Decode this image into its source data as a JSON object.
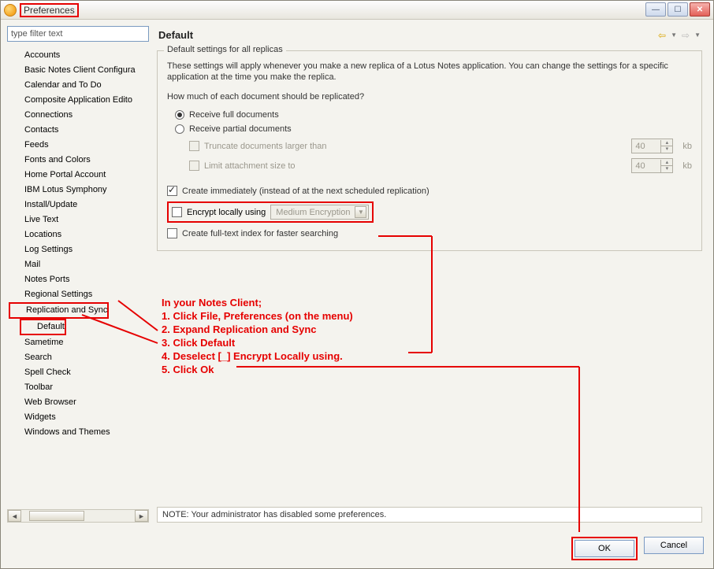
{
  "window": {
    "title": "Preferences"
  },
  "filter": {
    "placeholder": "type filter text"
  },
  "tree": {
    "items": [
      {
        "label": "Accounts"
      },
      {
        "label": "Basic Notes Client Configura"
      },
      {
        "label": "Calendar and To Do"
      },
      {
        "label": "Composite Application Edito"
      },
      {
        "label": "Connections"
      },
      {
        "label": "Contacts"
      },
      {
        "label": "Feeds"
      },
      {
        "label": "Fonts and Colors"
      },
      {
        "label": "Home Portal Account"
      },
      {
        "label": "IBM Lotus Symphony"
      },
      {
        "label": "Install/Update"
      },
      {
        "label": "Live Text"
      },
      {
        "label": "Locations"
      },
      {
        "label": "Log Settings"
      },
      {
        "label": "Mail"
      },
      {
        "label": "Notes Ports"
      },
      {
        "label": "Regional Settings"
      },
      {
        "label": "Replication and Sync",
        "highlight": true
      },
      {
        "label": "Default",
        "child": true,
        "highlight": true
      },
      {
        "label": "Sametime"
      },
      {
        "label": "Search"
      },
      {
        "label": "Spell Check"
      },
      {
        "label": "Toolbar"
      },
      {
        "label": "Web Browser"
      },
      {
        "label": "Widgets"
      },
      {
        "label": "Windows and Themes"
      }
    ]
  },
  "page": {
    "title": "Default",
    "group_title": "Default settings for all replicas",
    "description": "These settings will apply whenever you make a new replica of a Lotus Notes application. You can change the settings for a specific application at the time you make the replica.",
    "question": "How much of each document should be replicated?",
    "radio_full": "Receive full documents",
    "radio_partial": "Receive partial documents",
    "truncate_label": "Truncate documents larger than",
    "truncate_value": "40",
    "truncate_unit": "kb",
    "limit_label": "Limit attachment size to",
    "limit_value": "40",
    "limit_unit": "kb",
    "create_immediately": "Create immediately (instead of at the next scheduled replication)",
    "encrypt_label": "Encrypt locally using",
    "encrypt_value": "Medium Encryption",
    "fulltext_label": "Create full-text index for faster searching",
    "note": "NOTE: Your administrator has disabled some preferences."
  },
  "instructions": {
    "line0": "In your Notes Client;",
    "line1": "1. Click File, Preferences (on the menu)",
    "line2": "2. Expand Replication and Sync",
    "line3": "3. Click Default",
    "line4": "4. Deselect [_] Encrypt Locally using.",
    "line5": "5. Click Ok"
  },
  "buttons": {
    "ok": "OK",
    "cancel": "Cancel"
  }
}
